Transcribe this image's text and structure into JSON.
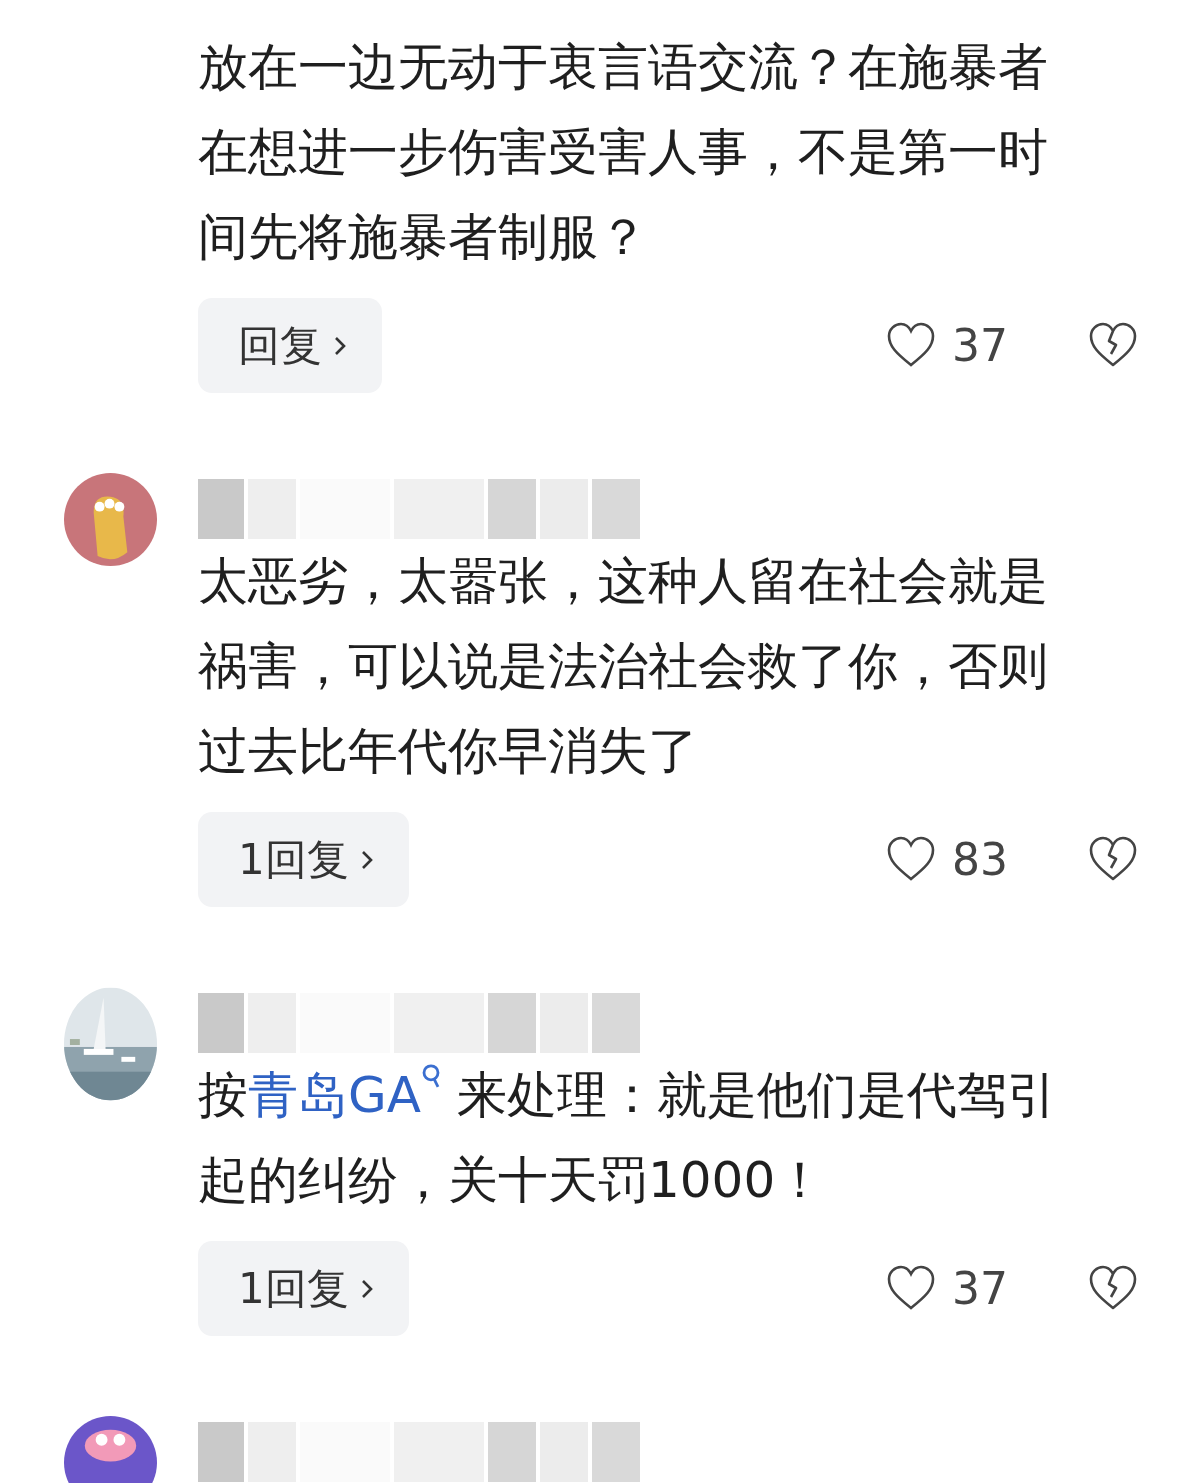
{
  "comments": [
    {
      "lines": [
        [
          {
            "kind": "text",
            "text": "放在一边无动于衷言语交流？在施暴者"
          }
        ],
        [
          {
            "kind": "text",
            "text": "在想进一步伤害受害人事，不是第一时"
          }
        ],
        [
          {
            "kind": "text",
            "text": "间先将施暴者制服？"
          }
        ]
      ],
      "reply": "回复",
      "likes": "37"
    },
    {
      "avatar": {
        "kind": "cartoon"
      },
      "lines": [
        [
          {
            "kind": "text",
            "text": "太恶劣，太嚣张，这种人留在社会就是"
          }
        ],
        [
          {
            "kind": "text",
            "text": "祸害，可以说是法治社会救了你，否则"
          }
        ],
        [
          {
            "kind": "text",
            "text": "过去比年代你早消失了"
          }
        ]
      ],
      "reply": "1回复",
      "likes": "83"
    },
    {
      "avatar": {
        "kind": "picture"
      },
      "lines": [
        [
          {
            "kind": "text",
            "text": "按"
          },
          {
            "kind": "link",
            "text": "青岛GA"
          },
          {
            "kind": "text",
            "text": " 来处理：就是他们是代驾引"
          }
        ],
        [
          {
            "kind": "text",
            "text": "起的纠纷，关十天罚1000！"
          }
        ]
      ],
      "reply": "1回复",
      "likes": "37"
    },
    {
      "avatar": {
        "kind": "cartoon2"
      }
    }
  ]
}
